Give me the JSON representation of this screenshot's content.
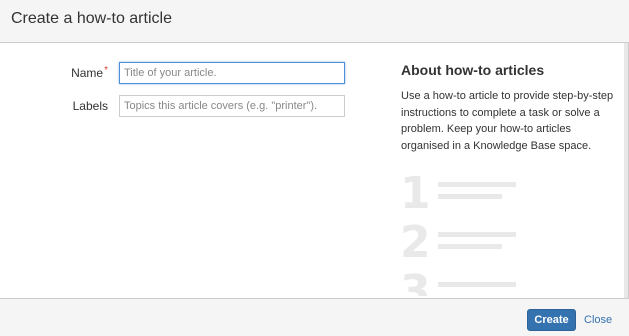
{
  "dialog": {
    "title": "Create a how-to article"
  },
  "form": {
    "name_label": "Name",
    "name_required_marker": "*",
    "name_value": "",
    "name_placeholder": "Title of your article.",
    "labels_label": "Labels",
    "labels_value": "",
    "labels_placeholder": "Topics this article covers (e.g. \"printer\")."
  },
  "about": {
    "title": "About how-to articles",
    "text": "Use a how-to article to provide step-by-step instructions to complete a task or solve a problem. Keep your how-to articles organised in a Knowledge Base space.",
    "steps": [
      "1",
      "2",
      "3"
    ],
    "illustration_color": "#e9e9e9"
  },
  "footer": {
    "create_label": "Create",
    "close_label": "Close"
  },
  "colors": {
    "primary": "#3572b0",
    "required": "#d04437",
    "focus_border": "#4a90d9"
  }
}
